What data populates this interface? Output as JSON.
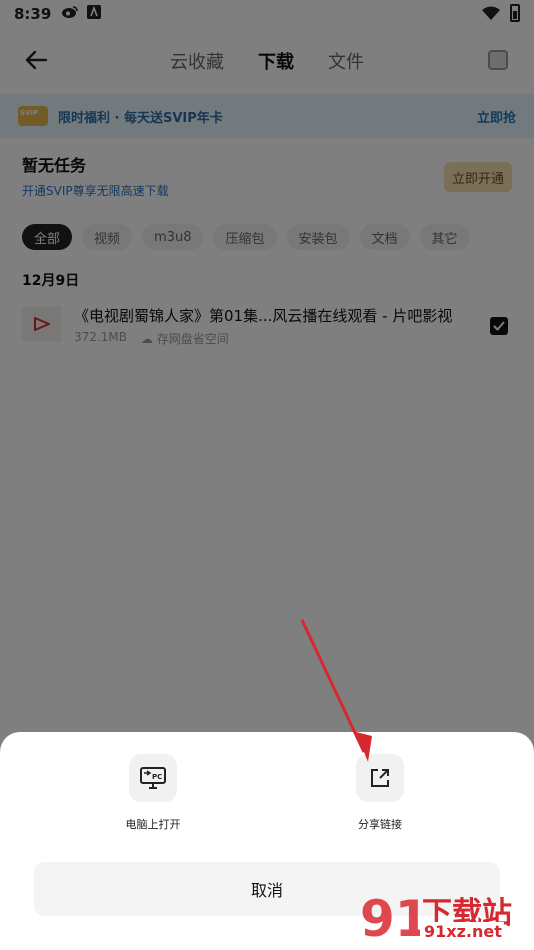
{
  "status": {
    "time": "8:39"
  },
  "header": {
    "tabs": [
      "云收藏",
      "下载",
      "文件"
    ],
    "active_tab": 1
  },
  "banner": {
    "text": "限时福利 · 每天送SVIP年卡",
    "link": "立即抢"
  },
  "notask": {
    "title": "暂无任务",
    "subtitle": "开通SVIP尊享无限高速下载",
    "button": "立即开通"
  },
  "filters": [
    "全部",
    "视频",
    "m3u8",
    "压缩包",
    "安装包",
    "文档",
    "其它"
  ],
  "date": "12月9日",
  "file": {
    "name": "《电视剧蜀锦人家》第01集...风云播在线观看 - 片吧影视",
    "size": "372.1MB",
    "location": "存网盘省空间"
  },
  "sheet": {
    "actions": [
      {
        "label": "电脑上打开",
        "icon": "pc-open-icon"
      },
      {
        "label": "分享链接",
        "icon": "share-link-icon"
      }
    ],
    "cancel": "取消"
  },
  "watermark": {
    "text": "下载站",
    "url": "91xz.net"
  },
  "colors": {
    "accent_red": "#d8282f",
    "banner_bg": "#e7f4fb",
    "vip_btn": "#f4e1b5"
  }
}
